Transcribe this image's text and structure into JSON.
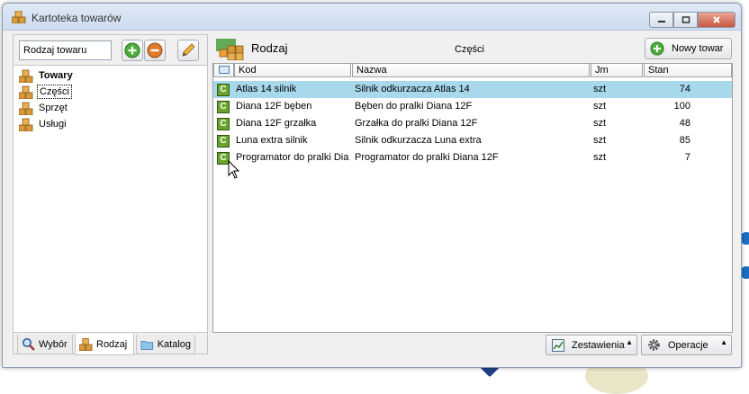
{
  "window": {
    "title": "Kartoteka towarów",
    "minimize_icon": "minimize-icon",
    "maximize_icon": "maximize-icon",
    "close_icon": "close-icon"
  },
  "left_panel": {
    "filter_input": {
      "value": "Rodzaj towaru"
    },
    "toolbar": [
      "add-icon",
      "remove-icon",
      "edit-pencil-icon"
    ],
    "tree": [
      {
        "label": "Towary",
        "icon": "boxes-icon",
        "bold": true,
        "selected": false
      },
      {
        "label": "Części",
        "icon": "boxes-icon",
        "bold": false,
        "selected": true
      },
      {
        "label": "Sprzęt",
        "icon": "boxes-icon",
        "bold": false,
        "selected": false
      },
      {
        "label": "Usługi",
        "icon": "boxes-icon",
        "bold": false,
        "selected": false
      }
    ],
    "tabs": [
      {
        "label": "Wybór",
        "icon": "magnifier-icon",
        "active": false
      },
      {
        "label": "Rodzaj",
        "icon": "boxes-icon",
        "active": true
      },
      {
        "label": "Katalog",
        "icon": "folder-icon",
        "active": false
      }
    ]
  },
  "right_panel": {
    "title": "Rodzaj",
    "current_category": "Części",
    "new_button": "Nowy towar",
    "columns": [
      "Kod",
      "Nazwa",
      "Jm",
      "Stan"
    ],
    "rows": [
      {
        "badge": "C",
        "kod": "Atlas 14 silnik",
        "nazwa": "Silnik odkurzacza Atlas 14",
        "jm": "szt",
        "stan": "74",
        "selected": true
      },
      {
        "badge": "C",
        "kod": "Diana 12F bęben",
        "nazwa": "Bęben do pralki Diana 12F",
        "jm": "szt",
        "stan": "100",
        "selected": false
      },
      {
        "badge": "C",
        "kod": "Diana 12F grzałka",
        "nazwa": "Grzałka do pralki Diana 12F",
        "jm": "szt",
        "stan": "48",
        "selected": false
      },
      {
        "badge": "C",
        "kod": "Luna extra silnik",
        "nazwa": "Silnik odkurzacza Luna extra",
        "jm": "szt",
        "stan": "85",
        "selected": false
      },
      {
        "badge": "C",
        "kod": "Programator do pralki Dia",
        "nazwa": "Programator do pralki Diana 12F",
        "jm": "szt",
        "stan": "7",
        "selected": false
      }
    ]
  },
  "bottom_bar": {
    "reports_button": "Zestawienia",
    "operations_button": "Operacje"
  },
  "colors": {
    "selection": "#a8d8ec",
    "badge_green": "#6aa32c",
    "add_green": "#4caf3a",
    "remove_orange": "#e07a2c"
  }
}
